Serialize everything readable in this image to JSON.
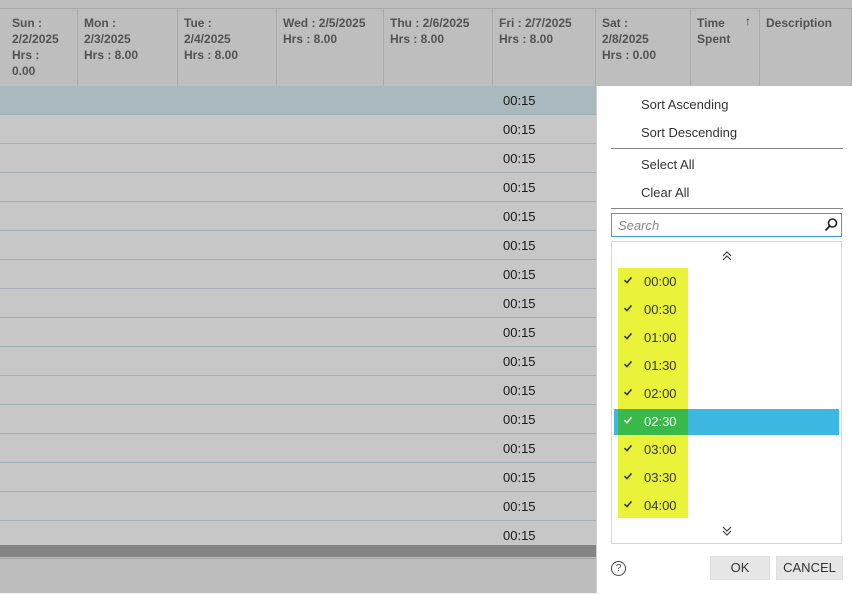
{
  "grid": {
    "columns": [
      {
        "id": "sun",
        "lines": [
          "Sun :",
          "2/2/2025",
          "Hrs :",
          "0.00"
        ]
      },
      {
        "id": "mon",
        "lines": [
          "Mon :",
          "2/3/2025",
          "Hrs : 8.00"
        ]
      },
      {
        "id": "tue",
        "lines": [
          "Tue :",
          "2/4/2025",
          "Hrs : 8.00"
        ]
      },
      {
        "id": "wed",
        "lines": [
          "Wed : 2/5/2025",
          "Hrs : 8.00"
        ]
      },
      {
        "id": "thu",
        "lines": [
          "Thu : 2/6/2025",
          "Hrs : 8.00"
        ]
      },
      {
        "id": "fri",
        "lines": [
          "Fri : 2/7/2025",
          "Hrs : 8.00"
        ]
      },
      {
        "id": "sat",
        "lines": [
          "Sat :",
          "2/8/2025",
          "Hrs : 0.00"
        ]
      },
      {
        "id": "time",
        "lines": [
          "Time",
          "Spent"
        ],
        "sort_icon": "↑"
      },
      {
        "id": "desc",
        "lines": [
          "Description"
        ]
      }
    ],
    "row_values": [
      "00:15",
      "00:15",
      "00:15",
      "00:15",
      "00:15",
      "00:15",
      "00:15",
      "00:15",
      "00:15",
      "00:15",
      "00:15",
      "00:15",
      "00:15",
      "00:15",
      "00:15",
      "00:15"
    ]
  },
  "filter_menu": {
    "sort_ascending": "Sort Ascending",
    "sort_descending": "Sort Descending",
    "select_all": "Select All",
    "clear_all": "Clear All",
    "search_placeholder": "Search",
    "scroll_up_icon": "double-chevron-up-icon",
    "scroll_down_icon": "double-chevron-down-icon",
    "options": [
      {
        "label": "00:00",
        "checked": true
      },
      {
        "label": "00:30",
        "checked": true
      },
      {
        "label": "01:00",
        "checked": true
      },
      {
        "label": "01:30",
        "checked": true
      },
      {
        "label": "02:00",
        "checked": true
      },
      {
        "label": "02:30",
        "checked": true,
        "selected": true
      },
      {
        "label": "03:00",
        "checked": true
      },
      {
        "label": "03:30",
        "checked": true
      },
      {
        "label": "04:00",
        "checked": true
      }
    ],
    "help_icon": "help-icon",
    "ok_label": "OK",
    "cancel_label": "CANCEL"
  },
  "colors": {
    "highlight_yellow": "#eaf33a",
    "selected_blue": "#3fb7e3",
    "selected_green": "#39b94a",
    "search_border": "#3aa0d8"
  }
}
